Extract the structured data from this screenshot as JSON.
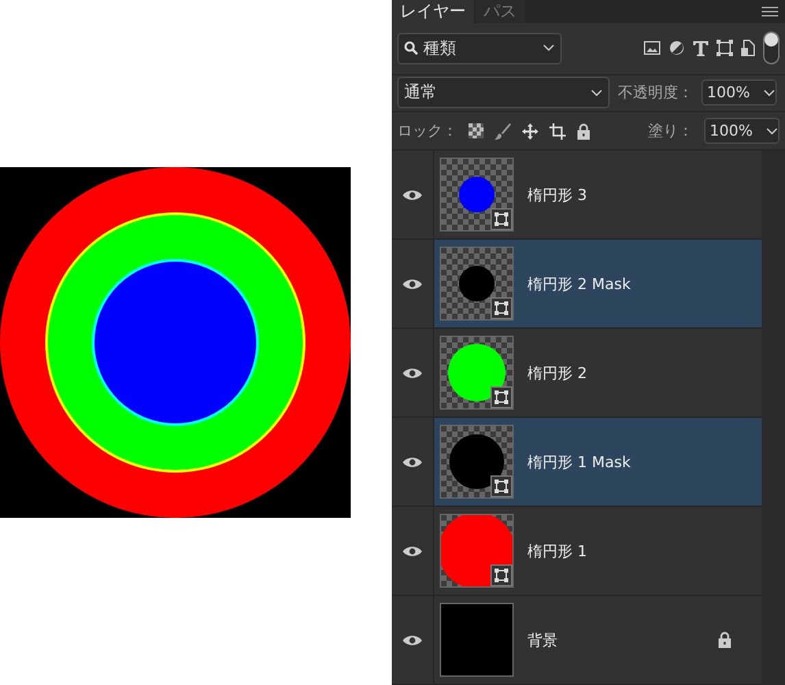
{
  "panel": {
    "tabs": [
      {
        "label": "レイヤー",
        "selected": true
      },
      {
        "label": "パス",
        "selected": false
      }
    ],
    "filter": {
      "value": "種類"
    },
    "filter_toggle": {
      "on": true
    },
    "blend_mode": {
      "value": "通常"
    },
    "opacity": {
      "label": "不透明度：",
      "value": "100%"
    },
    "lock": {
      "label": "ロック："
    },
    "fill": {
      "label": "塗り：",
      "value": "100%"
    },
    "layers": [
      {
        "name": "楕円形 3",
        "kind": "shape",
        "color": "#0000ff",
        "selected": false,
        "visible": true
      },
      {
        "name": "楕円形 2 Mask",
        "kind": "shape",
        "color": "#000000",
        "selected": true,
        "visible": true
      },
      {
        "name": "楕円形 2",
        "kind": "shape",
        "color": "#00ff00",
        "selected": false,
        "visible": true
      },
      {
        "name": "楕円形 1 Mask",
        "kind": "shape",
        "color": "#000000",
        "selected": true,
        "visible": true
      },
      {
        "name": "楕円形 1",
        "kind": "shape",
        "color": "#ff0000",
        "selected": false,
        "visible": true
      },
      {
        "name": "背景",
        "kind": "background",
        "color": "#000000",
        "selected": false,
        "visible": true,
        "locked": true
      }
    ]
  }
}
